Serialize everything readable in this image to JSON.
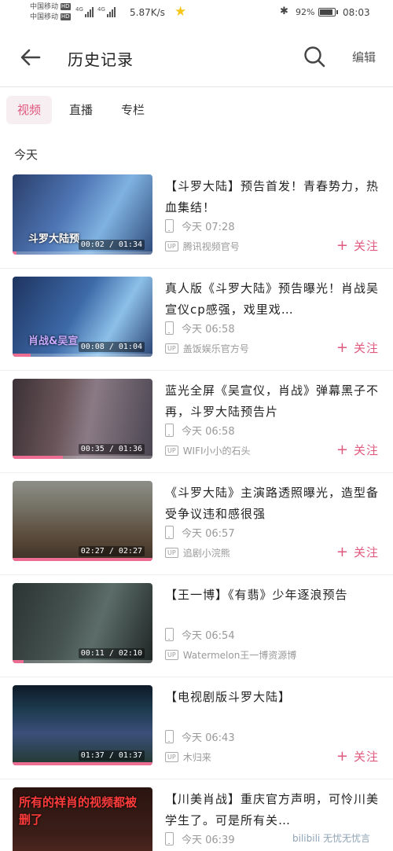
{
  "status_bar": {
    "carrier1": "中国移动",
    "carrier2": "中国移动",
    "hd": "HD",
    "net": "4G",
    "speed": "5.87K/s",
    "battery_pct": "92%",
    "time": "08:03"
  },
  "header": {
    "title": "历史记录",
    "edit_label": "编辑"
  },
  "tabs": [
    {
      "label": "视频",
      "active": true
    },
    {
      "label": "直播",
      "active": false
    },
    {
      "label": "专栏",
      "active": false
    }
  ],
  "section_label": "今天",
  "items": [
    {
      "title": "【斗罗大陆】预告首发！青春势力，热血集结！",
      "time": "今天 07:28",
      "uploader": "腾讯视频官号",
      "duration": "00:02 / 01:34",
      "caption": "斗罗大陆预",
      "progress": 0.02,
      "show_follow": true
    },
    {
      "title": "真人版《斗罗大陆》预告曝光！肖战吴宣仪cp感强，戏里戏…",
      "time": "今天 06:58",
      "uploader": "盖饭娱乐官方号",
      "duration": "00:08 / 01:04",
      "caption": "肖战&吴宣",
      "progress": 0.13,
      "show_follow": true
    },
    {
      "title": "蓝光全屏《吴宣仪，肖战》弹幕黑子不再，斗罗大陆预告片",
      "time": "今天 06:58",
      "uploader": "WIFI小小的石头",
      "duration": "00:35 / 01:36",
      "caption": "",
      "progress": 0.36,
      "show_follow": true
    },
    {
      "title": "《斗罗大陆》主演路透照曝光，造型备受争议违和感很强",
      "time": "今天 06:57",
      "uploader": "追剧小浣熊",
      "duration": "02:27 / 02:27",
      "caption": "",
      "progress": 1.0,
      "show_follow": true
    },
    {
      "title": "【王一博】《有翡》少年逐浪预告",
      "time": "今天 06:54",
      "uploader": "Watermelon王一博资源博",
      "duration": "00:11 / 02:10",
      "caption": "",
      "progress": 0.08,
      "show_follow": false
    },
    {
      "title": "【电视剧版斗罗大陆】",
      "time": "今天 06:43",
      "uploader": "木归来",
      "duration": "01:37 / 01:37",
      "caption": "",
      "progress": 1.0,
      "show_follow": true
    },
    {
      "title": "【川美肖战】重庆官方声明，可怜川美学生了。可是所有关…",
      "time": "今天 06:39",
      "uploader": "",
      "duration": "",
      "caption": "所有的祥肖的视频都被删了",
      "progress": 0,
      "show_follow": false
    }
  ],
  "follow_label": "关注",
  "up_badge": "UP",
  "watermark": "bilibili 无忧无忧言",
  "colors": {
    "accent": "#e0587e",
    "progress": "#ee6d93",
    "tab_active_bg": "#f6eef1"
  }
}
